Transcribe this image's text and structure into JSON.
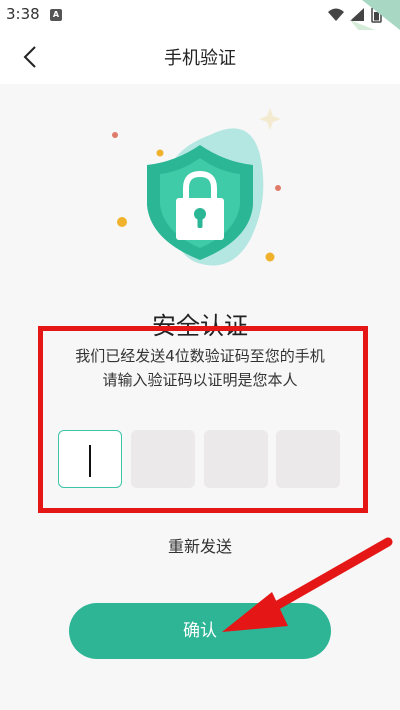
{
  "status_bar": {
    "time": "3:38",
    "app_icon_letter": "A"
  },
  "header": {
    "title": "手机验证"
  },
  "verification": {
    "title": "安全认证",
    "instruction_line1": "我们已经发送4位数验证码至您的手机",
    "instruction_line2": "请输入验证码以证明是您本人",
    "code_length": 4,
    "entered_digits": ""
  },
  "actions": {
    "resend_label": "重新发送",
    "confirm_label": "确认"
  },
  "colors": {
    "accent": "#2db596",
    "active_border": "#3cc4a6",
    "highlight": "#e51616",
    "empty_box": "#ebe9e9"
  }
}
